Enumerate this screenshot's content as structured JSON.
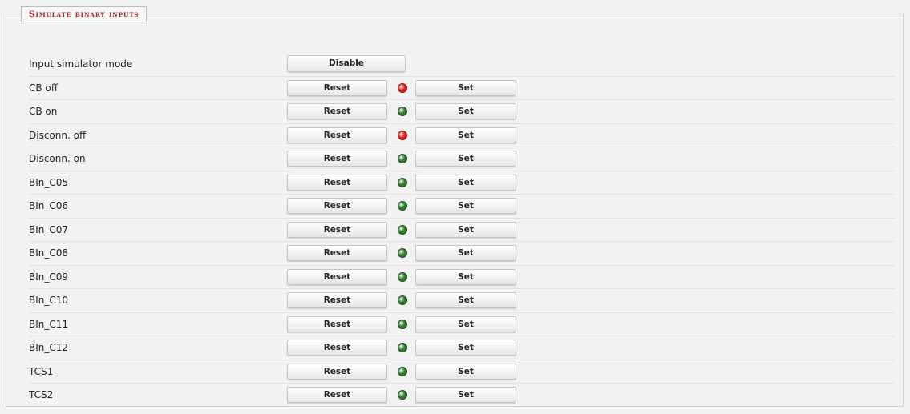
{
  "section": {
    "title": "Simulate binary inputs"
  },
  "mode_row": {
    "label": "Input simulator mode",
    "button_label": "Disable"
  },
  "buttons": {
    "reset_label": "Reset",
    "set_label": "Set"
  },
  "led_colors": {
    "on": "#e32020",
    "off": "#2f7a2f"
  },
  "inputs": [
    {
      "label": "CB off",
      "state": "on"
    },
    {
      "label": "CB on",
      "state": "off"
    },
    {
      "label": "Disconn. off",
      "state": "on"
    },
    {
      "label": "Disconn. on",
      "state": "off"
    },
    {
      "label": "BIn_C05",
      "state": "off"
    },
    {
      "label": "BIn_C06",
      "state": "off"
    },
    {
      "label": "BIn_C07",
      "state": "off"
    },
    {
      "label": "BIn_C08",
      "state": "off"
    },
    {
      "label": "BIn_C09",
      "state": "off"
    },
    {
      "label": "BIn_C10",
      "state": "off"
    },
    {
      "label": "BIn_C11",
      "state": "off"
    },
    {
      "label": "BIn_C12",
      "state": "off"
    },
    {
      "label": "TCS1",
      "state": "off"
    },
    {
      "label": "TCS2",
      "state": "off"
    }
  ]
}
